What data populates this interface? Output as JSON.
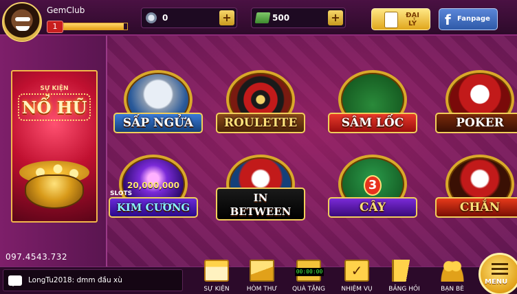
{
  "app": {
    "name": "GemClub"
  },
  "user": {
    "name": "GemClub",
    "level": "1",
    "level_progress": 0.95
  },
  "currency": {
    "coins": "0",
    "cash": "500"
  },
  "header_buttons": {
    "daily_label_1": "ĐẠI",
    "daily_label_2": "LÝ",
    "facebook_label": "Fanpage"
  },
  "event": {
    "subtitle": "SỰ KIỆN",
    "title": "NỔ HŨ",
    "carousel_pages": 2,
    "carousel_active": 1
  },
  "hotline": "097.4543.732",
  "games": [
    {
      "label": "SẤP NGỬA"
    },
    {
      "label": "ROULETTE"
    },
    {
      "label": "SÂM LỐC"
    },
    {
      "label": "POKER"
    },
    {
      "label": "20,000,000",
      "sub": "SLOTS",
      "name": "KIM CƯƠNG"
    },
    {
      "label": "IN",
      "label2": "BETWEEN"
    },
    {
      "label": "3",
      "label2": "CÂY"
    },
    {
      "label": "CHẮN"
    }
  ],
  "chat": {
    "message": "LongTu2018: dmm đầu xù"
  },
  "nav": [
    {
      "label": "SỰ KIỆN",
      "icon": "calendar-icon"
    },
    {
      "label": "HÒM THƯ",
      "icon": "mail-icon"
    },
    {
      "label": "QUÀ TẶNG",
      "icon": "gift-timer-icon",
      "timer": "00:00:00"
    },
    {
      "label": "NHIỆM VỤ",
      "icon": "clipboard-check-icon"
    },
    {
      "label": "BẢNG HỎI",
      "icon": "flag-icon"
    },
    {
      "label": "BẠN BÈ",
      "icon": "friends-icon"
    }
  ],
  "menu": {
    "label": "MENU"
  },
  "colors": {
    "accent_gold": "#e1a61c",
    "background": "#6d1a5a",
    "facebook": "#2f5aa8",
    "danger": "#c81e1e"
  }
}
